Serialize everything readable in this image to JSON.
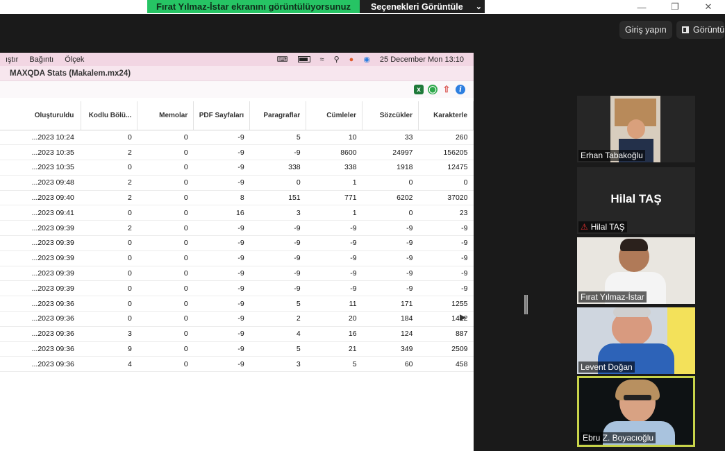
{
  "share_banner": {
    "message": "Fırat Yılmaz-İstar ekranını görüntülüyorsunuz",
    "options_label": "Seçenekleri Görüntüle"
  },
  "zoom_top": {
    "signin_label": "Giriş yapın",
    "view_label": "Görüntü"
  },
  "mac": {
    "menus": [
      "ıştır",
      "Bağıntı",
      "Ölçek"
    ],
    "datetime": "25 December Mon  13:10",
    "app_title": "MAXQDA Stats (Makalem.mx24)"
  },
  "table": {
    "headers": [
      "Oluşturuldu",
      "Kodlu Bölü...",
      "Memolar",
      "PDF Sayfaları",
      "Paragraflar",
      "Cümleler",
      "Sözcükler",
      "Karakterle"
    ],
    "rows": [
      [
        "...2023 10:24",
        "0",
        "0",
        "-9",
        "5",
        "10",
        "33",
        "260"
      ],
      [
        "...2023 10:35",
        "2",
        "0",
        "-9",
        "-9",
        "8600",
        "24997",
        "156205"
      ],
      [
        "...2023 10:35",
        "0",
        "0",
        "-9",
        "338",
        "338",
        "1918",
        "12475"
      ],
      [
        "...2023 09:48",
        "2",
        "0",
        "-9",
        "0",
        "1",
        "0",
        "0"
      ],
      [
        "...2023 09:40",
        "2",
        "0",
        "8",
        "151",
        "771",
        "6202",
        "37020"
      ],
      [
        "...2023 09:41",
        "0",
        "0",
        "16",
        "3",
        "1",
        "0",
        "23"
      ],
      [
        "...2023 09:39",
        "2",
        "0",
        "-9",
        "-9",
        "-9",
        "-9",
        "-9"
      ],
      [
        "...2023 09:39",
        "0",
        "0",
        "-9",
        "-9",
        "-9",
        "-9",
        "-9"
      ],
      [
        "...2023 09:39",
        "0",
        "0",
        "-9",
        "-9",
        "-9",
        "-9",
        "-9"
      ],
      [
        "...2023 09:39",
        "0",
        "0",
        "-9",
        "-9",
        "-9",
        "-9",
        "-9"
      ],
      [
        "...2023 09:39",
        "0",
        "0",
        "-9",
        "-9",
        "-9",
        "-9",
        "-9"
      ],
      [
        "...2023 09:36",
        "0",
        "0",
        "-9",
        "5",
        "11",
        "171",
        "1255"
      ],
      [
        "...2023 09:36",
        "0",
        "0",
        "-9",
        "2",
        "20",
        "184",
        "1412"
      ],
      [
        "...2023 09:36",
        "3",
        "0",
        "-9",
        "4",
        "16",
        "124",
        "887"
      ],
      [
        "...2023 09:36",
        "9",
        "0",
        "-9",
        "5",
        "21",
        "349",
        "2509"
      ],
      [
        "...2023 09:36",
        "4",
        "0",
        "-9",
        "3",
        "5",
        "60",
        "458"
      ]
    ]
  },
  "participants": [
    {
      "name": "Erhan Tabakoğlu"
    },
    {
      "name": "Hilal TAŞ",
      "big_label": "Hilal TAŞ"
    },
    {
      "name": "Fırat Yılmaz-İstar"
    },
    {
      "name": "Levent Doğan"
    },
    {
      "name": "Ebru Z. Boyacıoğlu"
    }
  ]
}
